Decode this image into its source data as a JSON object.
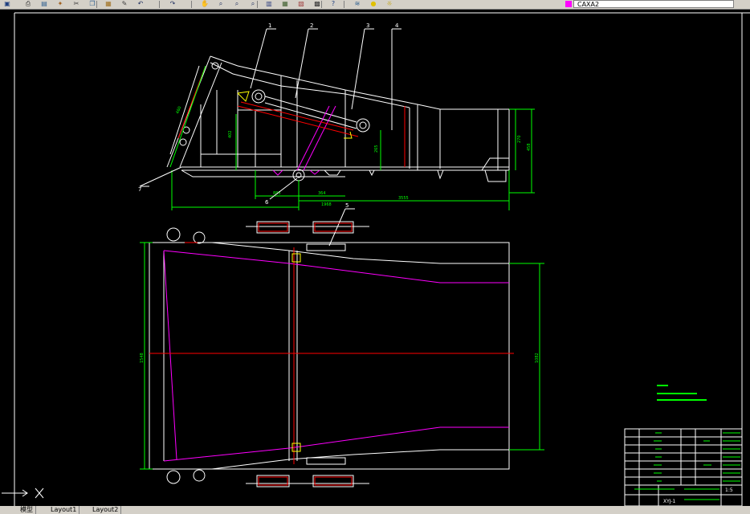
{
  "toolbar": {
    "buttons": [
      {
        "name": "save-icon",
        "glyph": "▣",
        "color": "#204080"
      },
      {
        "name": "print-icon",
        "glyph": "⎙",
        "color": "#303030"
      },
      {
        "name": "plot-preview-icon",
        "glyph": "▤",
        "color": "#306090"
      },
      {
        "name": "publish-icon",
        "glyph": "✦",
        "color": "#a06020"
      },
      {
        "name": "cut-icon",
        "glyph": "✂",
        "color": "#404040"
      },
      {
        "name": "copy-icon",
        "glyph": "❐",
        "color": "#306090"
      },
      {
        "name": "paste-icon",
        "glyph": "▦",
        "color": "#a07020"
      },
      {
        "name": "match-properties-icon",
        "glyph": "✎",
        "color": "#404040"
      },
      {
        "name": "undo-icon",
        "glyph": "↶",
        "color": "#203060"
      },
      {
        "name": "redo-icon",
        "glyph": "↷",
        "color": "#203060"
      },
      {
        "name": "pan-icon",
        "glyph": "✋",
        "color": "#a04040"
      },
      {
        "name": "zoom-realtime-icon",
        "glyph": "⌕",
        "color": "#203060"
      },
      {
        "name": "zoom-window-icon",
        "glyph": "⌕",
        "color": "#203060"
      },
      {
        "name": "zoom-previous-icon",
        "glyph": "⌕",
        "color": "#203060"
      },
      {
        "name": "properties-icon",
        "glyph": "▥",
        "color": "#304080"
      },
      {
        "name": "design-center-icon",
        "glyph": "▦",
        "color": "#406030"
      },
      {
        "name": "tool-palettes-icon",
        "glyph": "▧",
        "color": "#a04040"
      },
      {
        "name": "calculator-icon",
        "glyph": "▩",
        "color": "#303030"
      },
      {
        "name": "help-icon",
        "glyph": "?",
        "color": "#204080"
      },
      {
        "name": "layer-manager-icon",
        "glyph": "≋",
        "color": "#306090"
      },
      {
        "name": "layer-bulb-icon",
        "glyph": "●",
        "color": "#e0c000"
      },
      {
        "name": "layer-sun-icon",
        "glyph": "☼",
        "color": "#c0a000"
      }
    ],
    "layer_color": "#ff00ff",
    "layer_name": "CAXA2"
  },
  "tabs": {
    "model": "模型",
    "layout1": "Layout1",
    "layout2": "Layout2"
  },
  "drawing": {
    "balloons": [
      "1",
      "2",
      "3",
      "4",
      "5",
      "6",
      "7"
    ],
    "dims": {
      "left_slant": "460",
      "h1": "402",
      "h2": "265",
      "right_v1": "270",
      "right_v2": "458",
      "b1": "883",
      "b2": "364",
      "b3": "1968",
      "b4": "3555",
      "plan_left": "1548",
      "plan_right": "1082"
    },
    "colors": {
      "outline": "#ffffff",
      "dimension": "#00ff00",
      "accent": "#ff00ff",
      "center": "#ff0000",
      "tag": "#ffff00"
    }
  },
  "title_block": {
    "scale": "1:5",
    "drawing_no": "XYJ-1"
  }
}
